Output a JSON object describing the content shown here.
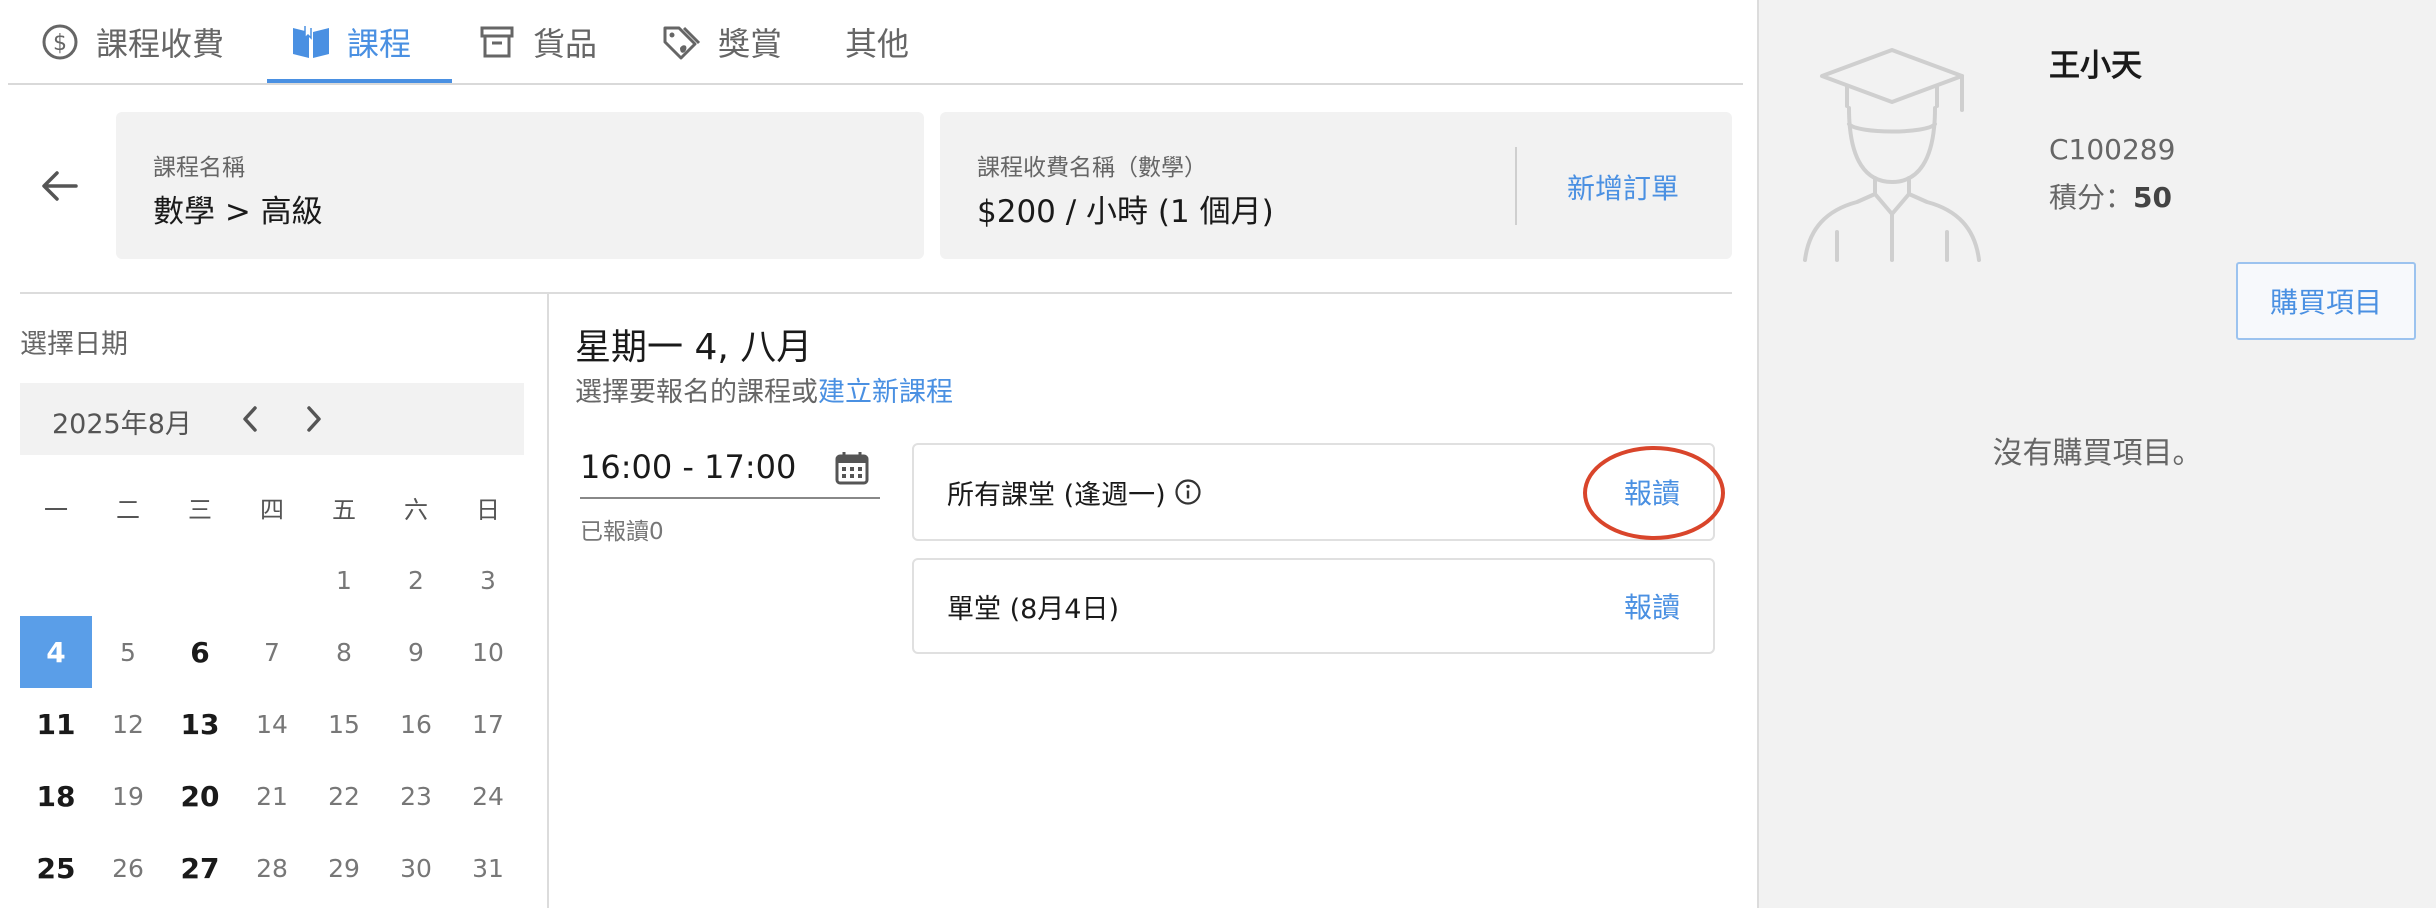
{
  "tabs": [
    {
      "label": "課程收費",
      "icon": "dollar-circle-icon"
    },
    {
      "label": "課程",
      "icon": "open-book-icon",
      "active": true
    },
    {
      "label": "貨品",
      "icon": "archive-box-icon"
    },
    {
      "label": "獎賞",
      "icon": "tags-icon"
    },
    {
      "label": "其他",
      "icon": ""
    }
  ],
  "course_card": {
    "label": "課程名稱",
    "value": "數學 > 高級"
  },
  "fee_card": {
    "label": "課程收費名稱（數學）",
    "value": "$200 / 小時 (1 個月)",
    "action": "新增訂單"
  },
  "calendar": {
    "label": "選擇日期",
    "month": "2025年8月",
    "weekdays": [
      "一",
      "二",
      "三",
      "四",
      "五",
      "六",
      "日"
    ],
    "weeks": [
      [
        "",
        "",
        "",
        "",
        "1",
        "2",
        "3"
      ],
      [
        "4",
        "5",
        "6",
        "7",
        "8",
        "9",
        "10"
      ],
      [
        "11",
        "12",
        "13",
        "14",
        "15",
        "16",
        "17"
      ],
      [
        "18",
        "19",
        "20",
        "21",
        "22",
        "23",
        "24"
      ],
      [
        "25",
        "26",
        "27",
        "28",
        "29",
        "30",
        "31"
      ]
    ],
    "selected_day": "4",
    "bold_days": [
      "6",
      "11",
      "13",
      "18",
      "20",
      "25",
      "27"
    ]
  },
  "schedule": {
    "date_title": "星期一 4, 八月",
    "subtitle": "選擇要報名的課程或",
    "create_link": "建立新課程",
    "time_slot": "16:00 - 17:00",
    "enrolled": "已報讀0",
    "options": [
      {
        "label": "所有課堂 (逢週一)",
        "action": "報讀",
        "has_info": true
      },
      {
        "label": "單堂 (8月4日)",
        "action": "報讀",
        "has_info": false
      }
    ]
  },
  "student": {
    "name": "王小天",
    "code": "C100289",
    "points_label": "積分：",
    "points_value": "50",
    "buy_button": "購買項目",
    "empty_text": "沒有購買項目。"
  },
  "colors": {
    "accent": "#4a90e2",
    "selected": "#5a9ee8",
    "highlight": "#d9452b",
    "panel_bg": "#f2f2f2"
  }
}
